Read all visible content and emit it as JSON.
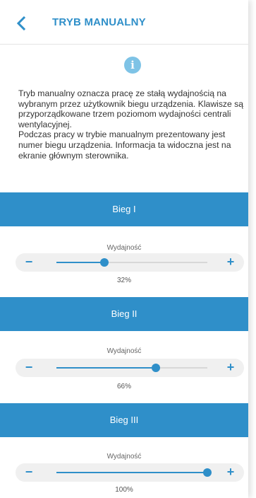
{
  "header": {
    "title": "TRYB MANUALNY",
    "back_icon": "chevron-left-icon"
  },
  "info": {
    "icon": "info-icon",
    "glyph": "i",
    "paragraph1": "Tryb manualny oznacza pracę ze stałą wydajnością na wybranym przez użytkownik biegu urządzenia. Klawisze są przyporządkowane trzem poziomom wydajności centrali wentylacyjnej.",
    "paragraph2": "Podczas pracy w trybie manualnym prezentowany jest numer biegu urządzenia. Informacja ta widoczna jest na ekranie głównym sterownika."
  },
  "accent_color": "#2f8fc9",
  "gears": [
    {
      "title": "Bieg I",
      "label": "Wydajność",
      "value": 32,
      "value_text": "32%",
      "minus": "−",
      "plus": "+"
    },
    {
      "title": "Bieg II",
      "label": "Wydajność",
      "value": 66,
      "value_text": "66%",
      "minus": "−",
      "plus": "+"
    },
    {
      "title": "Bieg III",
      "label": "Wydajność",
      "value": 100,
      "value_text": "100%",
      "minus": "−",
      "plus": "+"
    }
  ]
}
